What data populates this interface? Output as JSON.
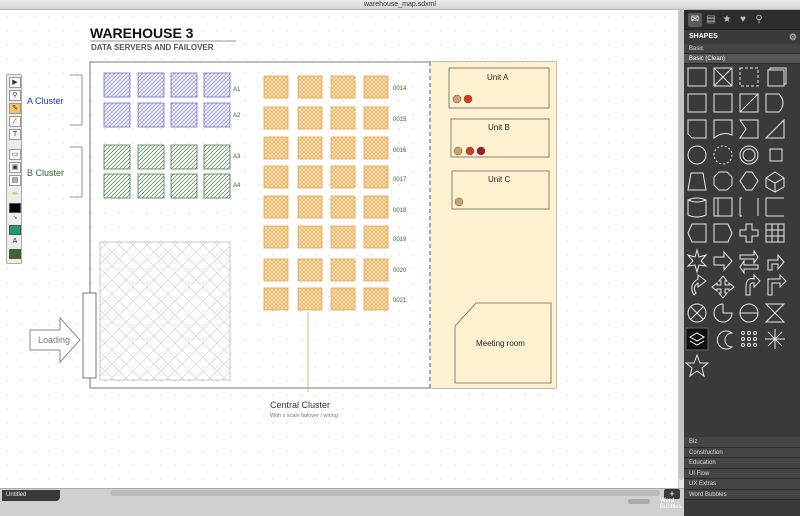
{
  "window": {
    "title": "warehouse_map.sdxml"
  },
  "diagram": {
    "title": "WAREHOUSE 3",
    "subtitle": "DATA SERVERS AND FAILOVER",
    "cluster_a_label": "A Cluster",
    "cluster_b_label": "B Cluster",
    "rack_rows_left": [
      "A1",
      "A2",
      "A3",
      "A4"
    ],
    "rack_rows_central": [
      "0014",
      "0015",
      "0016",
      "0017",
      "0018",
      "0019",
      "0020",
      "0021"
    ],
    "loading_label": "Loading",
    "central_cluster_label": "Central Cluster",
    "central_cluster_note": "With x scale failover / wiring",
    "units": [
      {
        "label": "Unit A",
        "status": [
          "#d2a06a",
          "#d13b1e"
        ]
      },
      {
        "label": "Unit B",
        "status": [
          "#d2a06a",
          "#d13b1e",
          "#a01b2a"
        ]
      },
      {
        "label": "Unit C",
        "status": [
          "#d2a06a"
        ]
      }
    ],
    "meeting_room_label": "Meeting room",
    "colors": {
      "a_cluster": "#6b6bd6",
      "b_cluster": "#4a7a4a",
      "central": "#e3a24a",
      "office_fill": "#fdf1cf",
      "a_label": "#2233cc",
      "b_label": "#2a6a2a"
    }
  },
  "tools": {
    "items": [
      "select-tool",
      "zoom-tool",
      "pencil-tool",
      "line-tool",
      "text-tool",
      "shape-tool",
      "image-tool",
      "note-tool",
      "brush-tool"
    ],
    "text_glyph": "T",
    "letter_glyph": "A",
    "fill_color": "#000000",
    "stroke_color": "#1a9a6a",
    "text_color": "#3a6a2a"
  },
  "panel": {
    "tab_icons": [
      "speech-bubble-icon",
      "chat-icon",
      "star-icon",
      "heart-icon",
      "search-icon"
    ],
    "header": "SHAPES",
    "libraries_top": [
      "Basic",
      "Basic (Clean)"
    ],
    "libraries_bottom": [
      "Biz",
      "Construction",
      "Education",
      "UI Flow",
      "UX Extras",
      "Word Bubbles"
    ]
  },
  "bottom": {
    "doc_tab": "Untitled",
    "add_button": "+",
    "extra_label": "Word Bubbles"
  }
}
